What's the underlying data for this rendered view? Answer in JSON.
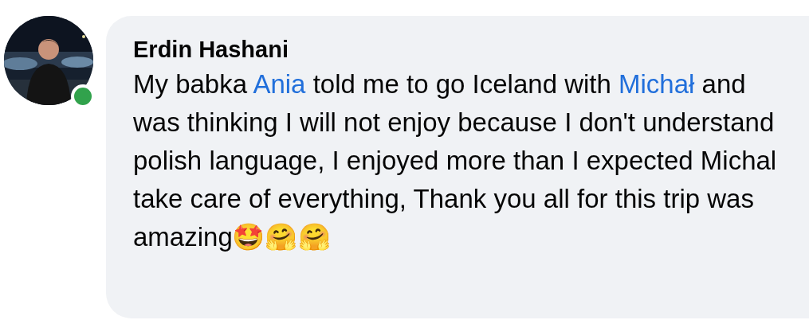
{
  "comment": {
    "author": "Erdin Hashani",
    "online": true,
    "segments": [
      {
        "kind": "text",
        "text": "My babka "
      },
      {
        "kind": "mention",
        "text": "Ania"
      },
      {
        "kind": "text",
        "text": " told me to go Iceland with "
      },
      {
        "kind": "mention",
        "text": "Michał"
      },
      {
        "kind": "text",
        "text": " and was thinking I will not enjoy because I don't understand polish language, I enjoyed more than I expected Michal take care of everything, Thank you all for this trip was amazing🤩🤗🤗"
      }
    ]
  }
}
